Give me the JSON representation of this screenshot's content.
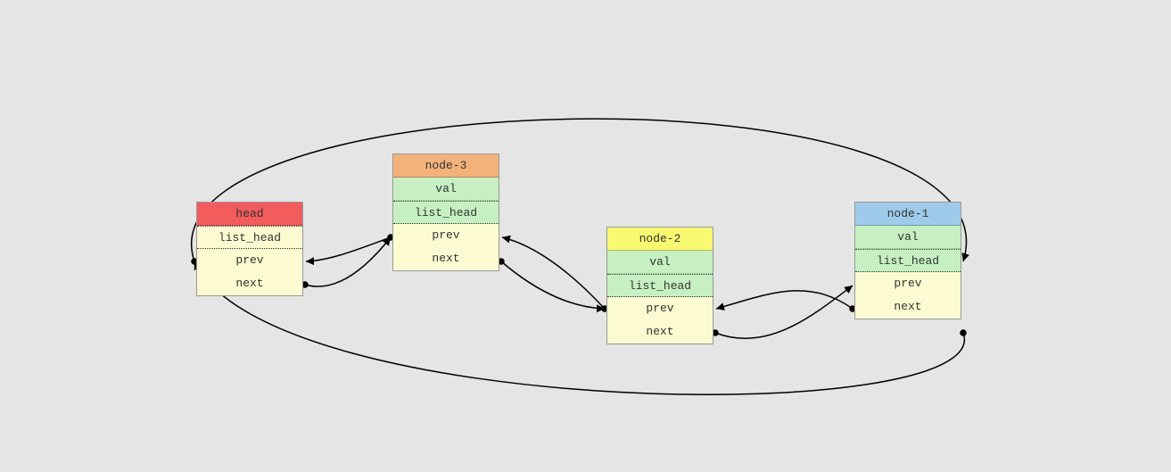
{
  "diagram": {
    "nodes": {
      "head": {
        "title": "head",
        "list_head": "list_head",
        "prev": "prev",
        "next": "next"
      },
      "node3": {
        "title": "node-3",
        "val": "val",
        "list_head": "list_head",
        "prev": "prev",
        "next": "next"
      },
      "node2": {
        "title": "node-2",
        "val": "val",
        "list_head": "list_head",
        "prev": "prev",
        "next": "next"
      },
      "node1": {
        "title": "node-1",
        "val": "val",
        "list_head": "list_head",
        "prev": "prev",
        "next": "next"
      }
    },
    "edges": [
      {
        "from": "head.next",
        "to": "node3.list_head"
      },
      {
        "from": "node3.next",
        "to": "node2.list_head"
      },
      {
        "from": "node2.next",
        "to": "node1.list_head"
      },
      {
        "from": "node1.next",
        "to": "head.list_head",
        "note": "wrap-around bottom"
      },
      {
        "from": "head.prev",
        "to": "node1.list_head",
        "note": "wrap-around top"
      },
      {
        "from": "node3.prev",
        "to": "head.list_head"
      },
      {
        "from": "node2.prev",
        "to": "node3.list_head"
      },
      {
        "from": "node1.prev",
        "to": "node2.list_head"
      }
    ]
  }
}
